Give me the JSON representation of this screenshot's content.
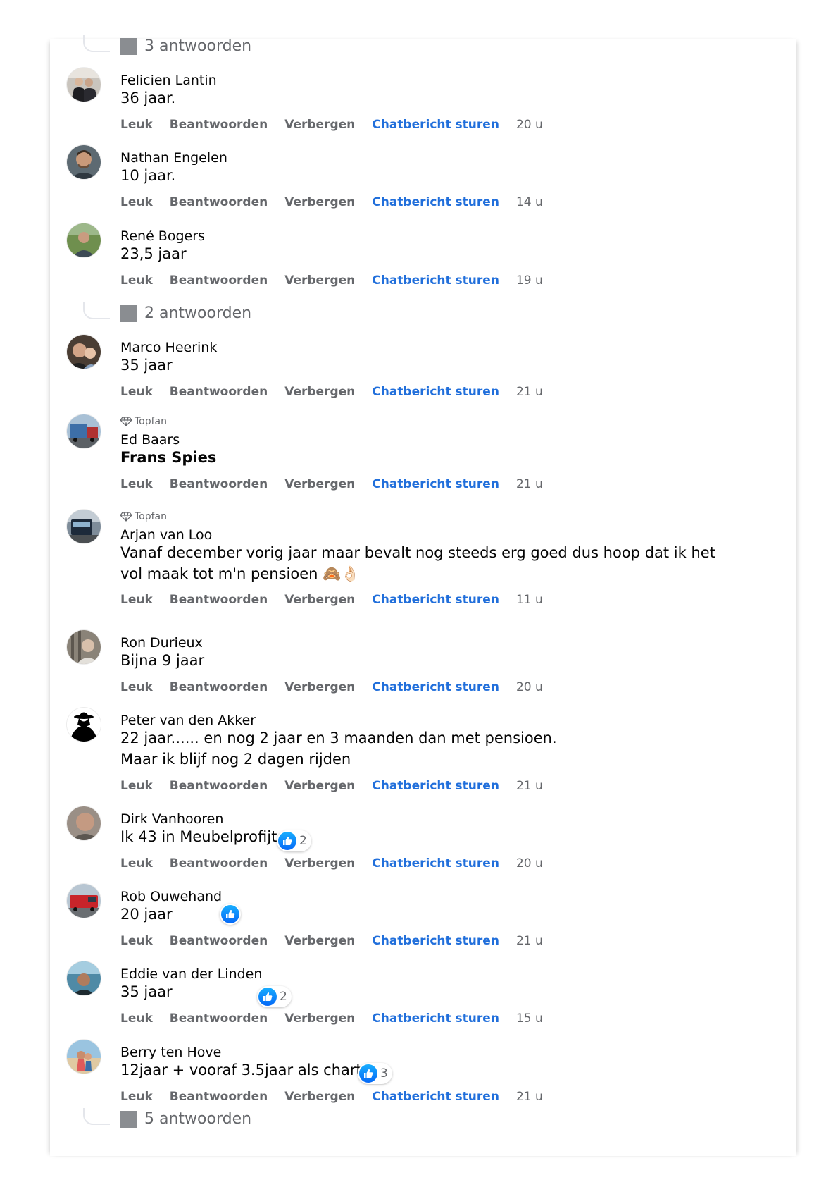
{
  "actions": {
    "like": "Leuk",
    "reply": "Beantwoorden",
    "hide": "Verbergen",
    "chat": "Chatbericht sturen"
  },
  "topfan_label": "Topfan",
  "replies_top": "3 antwoorden",
  "replies_after_rene": "2 antwoorden",
  "replies_bottom": "5 antwoorden",
  "colors": {
    "link_blue": "#216fdb",
    "meta_gray": "#65676b",
    "like_blue": "#0866ff"
  },
  "comments": [
    {
      "name": "Felicien Lantin",
      "text": "36 jaar.",
      "time": "20 u"
    },
    {
      "name": "Nathan Engelen",
      "text": "10 jaar.",
      "time": "14 u"
    },
    {
      "name": "René Bogers",
      "text": "23,5 jaar",
      "time": "19 u"
    },
    {
      "name": "Marco Heerink",
      "text": "35 jaar",
      "time": "21 u"
    },
    {
      "name": "Ed Baars",
      "text": "Frans Spies",
      "time": "21 u",
      "badge": "Topfan"
    },
    {
      "name": "Arjan van Loo",
      "text": "Vanaf december vorig jaar maar bevalt nog steeds erg goed dus hoop dat ik het vol maak tot m'n pensioen 🙈👌🏻",
      "time": "11 u",
      "badge": "Topfan"
    },
    {
      "name": "Ron Durieux",
      "text": "Bijna 9 jaar",
      "time": "20 u"
    },
    {
      "name": "Peter van den Akker",
      "text_line1": "22 jaar...... en nog 2 jaar en 3 maanden dan met pensioen.",
      "text_line2": "Maar ik blijf nog 2 dagen rijden",
      "time": "21 u"
    },
    {
      "name": "Dirk Vanhooren",
      "text": "Ik 43 in Meubelprofijt",
      "time": "20 u",
      "likes": "2"
    },
    {
      "name": "Rob Ouwehand",
      "text": "20 jaar",
      "time": "21 u"
    },
    {
      "name": "Eddie van der Linden",
      "text": "35 jaar",
      "time": "15 u",
      "likes": "2"
    },
    {
      "name": "Berry ten Hove",
      "text": "12jaar + vooraf 3.5jaar als charter",
      "time": "21 u",
      "likes": "3"
    }
  ]
}
